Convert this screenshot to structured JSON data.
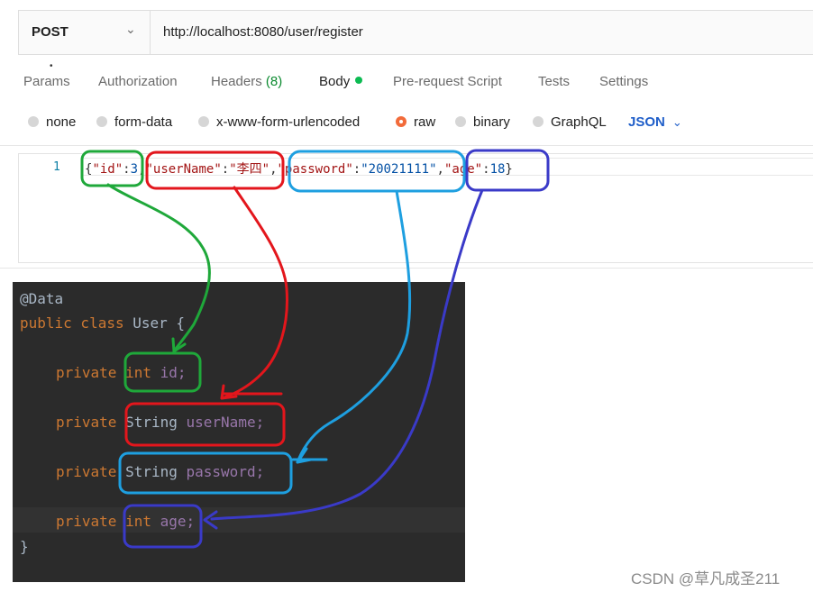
{
  "request": {
    "method": "POST",
    "url": "http://localhost:8080/user/register"
  },
  "tabs": {
    "params": "Params",
    "authorization": "Authorization",
    "headers": "Headers",
    "headers_count": "(8)",
    "body": "Body",
    "prerequest": "Pre-request Script",
    "tests": "Tests",
    "settings": "Settings"
  },
  "body_types": {
    "none": "none",
    "form_data": "form-data",
    "urlencoded": "x-www-form-urlencoded",
    "raw": "raw",
    "binary": "binary",
    "graphql": "GraphQL",
    "format": "JSON",
    "selected": "raw"
  },
  "editor": {
    "line_number": "1",
    "open": "{",
    "id_key": "\"id\"",
    "id_colon": ":",
    "id_val": "3",
    "sep1": ",",
    "username_key": "\"userName\"",
    "username_colon": ":",
    "username_val": "\"李四\"",
    "sep2": ",",
    "password_key": "\"password\"",
    "password_colon": ":",
    "password_val": "\"20021111\"",
    "sep3": ",",
    "age_key": "\"age\"",
    "age_colon": ":",
    "age_val": "18",
    "close": "}"
  },
  "ide": {
    "annotation": "@Data",
    "class_kw": "public class",
    "class_name": "User {",
    "private_kw": "private",
    "f1_type": "int",
    "f1_name": "id;",
    "f2_type": "String",
    "f2_name": "userName;",
    "f3_type": "String",
    "f3_name": "password;",
    "f4_type": "int",
    "f4_name": "age;",
    "close": "}"
  },
  "watermark": "CSDN @草凡成圣211",
  "colors": {
    "green_mark": "#1fa83a",
    "red_mark": "#e3161c",
    "cyan_mark": "#1e9fe0",
    "blue_mark": "#3a3ac8",
    "raw_radio": "#f26b3a",
    "json_label": "#1f5ec9"
  }
}
